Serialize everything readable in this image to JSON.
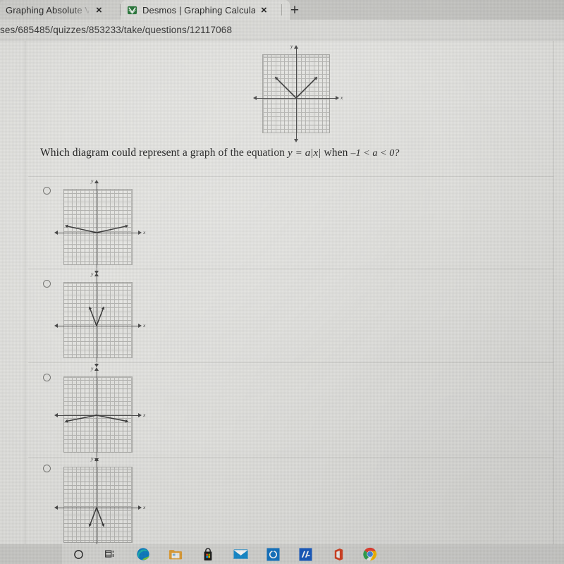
{
  "browser": {
    "tabs": [
      {
        "title": "Graphing Absolute Value F",
        "favicon": "none",
        "active": false,
        "close_label": "×"
      },
      {
        "title": "Desmos | Graphing Calculator",
        "favicon": "desmos-icon",
        "active": true,
        "close_label": "×"
      }
    ],
    "new_tab_label": "+",
    "url": "ses/685485/quizzes/853233/take/questions/12117068"
  },
  "question": {
    "lead": "Which diagram could represent a graph of the equation",
    "equation": "y = a|x|",
    "middle": "when",
    "condition": "–1 < a < 0?"
  },
  "stimulus": {
    "name": "stimulus-graph",
    "shape": "v-up-medium",
    "x_label": "x",
    "y_label": "y"
  },
  "options": [
    {
      "id": "option-a",
      "shape": "v-up-shallow",
      "x_label": "x",
      "y_label": "y",
      "selected": false
    },
    {
      "id": "option-b",
      "shape": "v-up-steep",
      "x_label": "x",
      "y_label": "y",
      "selected": false
    },
    {
      "id": "option-c",
      "shape": "v-down-shallow",
      "x_label": "x",
      "y_label": "y",
      "selected": false
    },
    {
      "id": "option-d",
      "shape": "v-down-steep",
      "x_label": "x",
      "y_label": "y",
      "selected": false
    }
  ],
  "taskbar": {
    "icons": [
      {
        "name": "search-icon",
        "label": "○"
      },
      {
        "name": "task-view-icon",
        "label": "task-view"
      },
      {
        "name": "microsoft-edge-icon",
        "label": "Edge"
      },
      {
        "name": "file-explorer-icon",
        "label": "File Explorer"
      },
      {
        "name": "microsoft-store-icon",
        "label": "Microsoft Store"
      },
      {
        "name": "mail-icon",
        "label": "Mail"
      },
      {
        "name": "blue-app-icon",
        "label": "App"
      },
      {
        "name": "blue-m-app-icon",
        "label": "M"
      },
      {
        "name": "microsoft-office-icon",
        "label": "Office"
      },
      {
        "name": "google-chrome-icon",
        "label": "Chrome"
      }
    ]
  },
  "colors": {
    "page_background": "#e5e5e2",
    "tabstrip": "#c9c9c6",
    "grid_line": "#b9b9b6",
    "axis": "#4a4a4a",
    "curve": "#3b3b3b",
    "divider": "#d2d2cf"
  }
}
